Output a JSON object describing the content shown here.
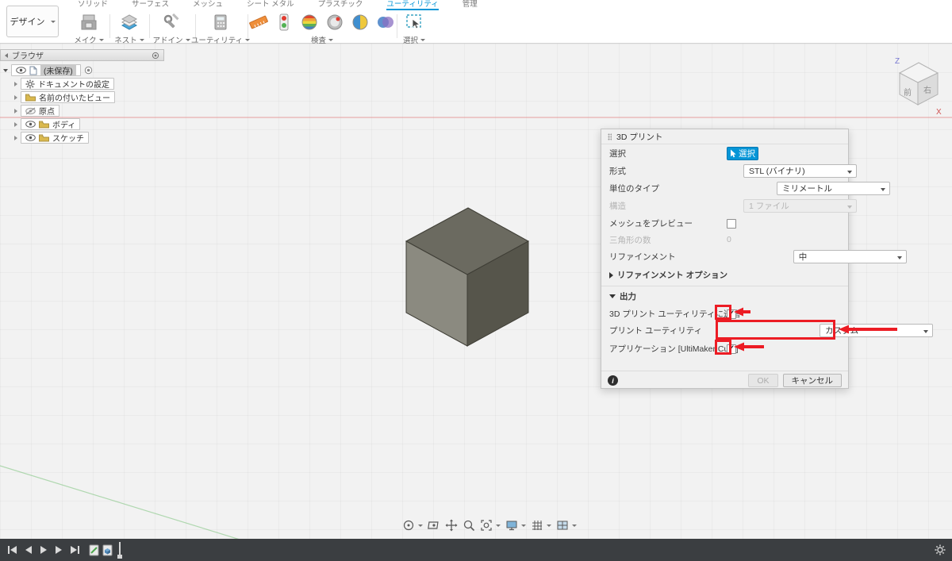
{
  "colors": {
    "accent_blue": "#0696d7",
    "annotation_red": "#ec1c24"
  },
  "icons": {
    "check": "✓",
    "info": "i"
  },
  "app": {
    "design_menu": "デザイン",
    "tabs": [
      {
        "label": "ソリッド"
      },
      {
        "label": "サーフェス"
      },
      {
        "label": "メッシュ"
      },
      {
        "label": "シート メタル"
      },
      {
        "label": "プラスチック"
      },
      {
        "label": "ユーティリティ",
        "active": true
      },
      {
        "label": "管理"
      }
    ],
    "toolbar_groups": [
      {
        "label": "メイク"
      },
      {
        "label": "ネスト"
      },
      {
        "label": "アドイン"
      },
      {
        "label": "ユーティリティ"
      },
      {
        "label": "検査"
      },
      {
        "label": "選択"
      }
    ]
  },
  "browser": {
    "title": "ブラウザ",
    "root_label": "(未保存)",
    "items": [
      {
        "label": "ドキュメントの設定"
      },
      {
        "label": "名前の付いたビュー"
      },
      {
        "label": "原点"
      },
      {
        "label": "ボディ"
      },
      {
        "label": "スケッチ"
      }
    ]
  },
  "viewcube": {
    "front": "前",
    "right": "右",
    "axis_z": "Z",
    "axis_x": "X"
  },
  "dialog": {
    "title": "3D プリント",
    "selection": {
      "label": "選択",
      "button": "選択"
    },
    "format": {
      "label": "形式",
      "value": "STL (バイナリ)"
    },
    "unit_type": {
      "label": "単位のタイプ",
      "value": "ミリメートル"
    },
    "structure": {
      "label": "構造",
      "value": "1 ファイル"
    },
    "preview_mesh": {
      "label": "メッシュをプレビュー",
      "checked": false
    },
    "triangle_count": {
      "label": "三角形の数",
      "value": "0"
    },
    "refinement": {
      "label": "リファインメント",
      "value": "中"
    },
    "refinement_options": {
      "label": "リファインメント オプション"
    },
    "output_section": {
      "label": "出力"
    },
    "send_to_print_utility": {
      "label": "3D プリント ユーティリティに送信",
      "checked": true
    },
    "print_utility": {
      "label": "プリント ユーティリティ",
      "value": "カスタム"
    },
    "application": {
      "label": "アプリケーション [UltiMaker Cura]",
      "checked": true
    },
    "ok": "OK",
    "cancel": "キャンセル"
  }
}
